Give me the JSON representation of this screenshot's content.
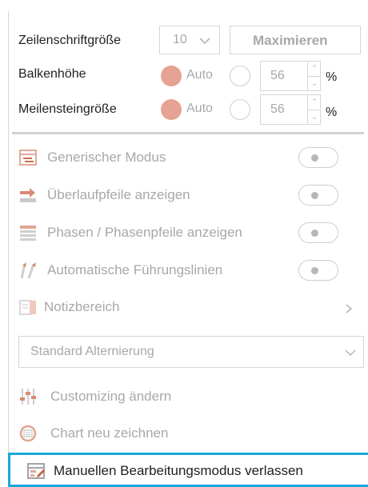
{
  "settings": {
    "font_size_label": "Zeilenschriftgröße",
    "font_size_value": "10",
    "maximize_label": "Maximieren",
    "bar_height_label": "Balkenhöhe",
    "bar_height_auto": "Auto",
    "bar_height_value": "56",
    "bar_height_unit": "%",
    "milestone_label": "Meilensteingröße",
    "milestone_auto": "Auto",
    "milestone_value": "56",
    "milestone_unit": "%"
  },
  "options": [
    {
      "label": "Generischer Modus",
      "icon": "generic-mode-icon",
      "toggle": "off"
    },
    {
      "label": "Überlaufpfeile anzeigen",
      "icon": "overflow-arrows-icon",
      "toggle": "off"
    },
    {
      "label": "Phasen / Phasenpfeile anzeigen",
      "icon": "phases-icon",
      "toggle": "off"
    },
    {
      "label": "Automatische Führungslinien",
      "icon": "guide-lines-icon",
      "toggle": "off"
    }
  ],
  "notes": {
    "label": "Notizbereich",
    "icon": "notes-icon",
    "chevron": "chevron-right-icon"
  },
  "alternation": {
    "value": "Standard Alternierung",
    "chevron": "chevron-down-icon"
  },
  "actions": [
    {
      "label": "Customizing ändern",
      "icon": "customize-icon"
    },
    {
      "label": "Chart neu zeichnen",
      "icon": "redraw-chart-icon"
    },
    {
      "label": "Manuellen Bearbeitungsmodus verlassen",
      "icon": "manual-edit-icon"
    }
  ],
  "colors": {
    "accent": "#1aa8d8",
    "radio_selected": "#e6a292",
    "disabled_text": "#a8a8a8"
  }
}
